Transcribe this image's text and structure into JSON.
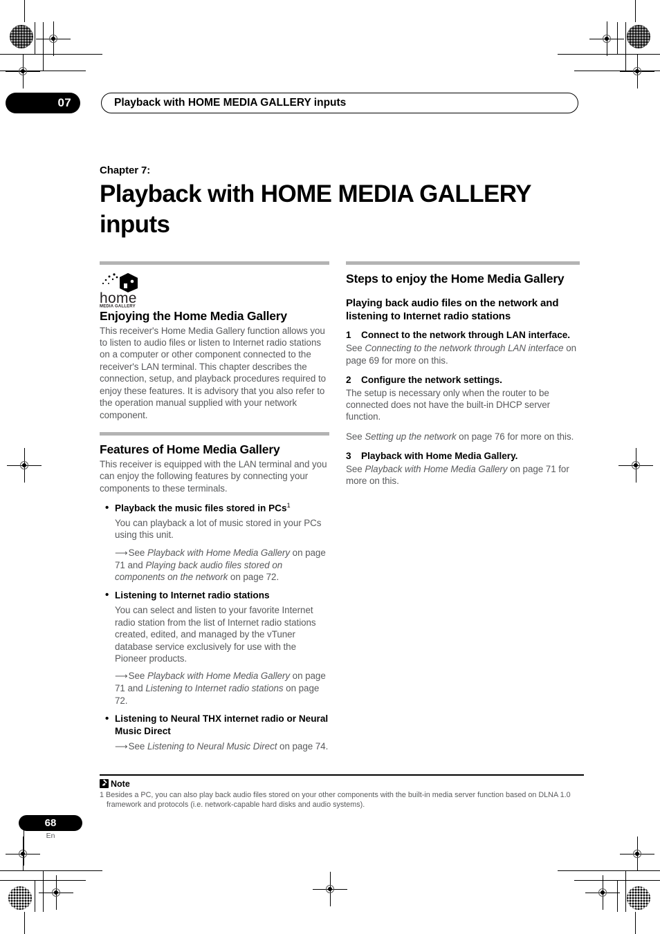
{
  "header": {
    "chapter_number": "07",
    "running_title": "Playback with HOME MEDIA GALLERY inputs"
  },
  "chapter": {
    "label": "Chapter 7:",
    "title": "Playback with HOME MEDIA GALLERY inputs"
  },
  "left_column": {
    "logo": {
      "wordmark": "home",
      "subtext": "MEDIA GALLERY"
    },
    "enjoying": {
      "heading": "Enjoying the Home Media Gallery",
      "body": "This receiver's Home Media Gallery function allows you to listen to audio files or listen to Internet radio stations on a computer or other component connected to the receiver's LAN terminal. This chapter describes the connection, setup, and playback procedures required to enjoy these features. It is advisory that you also refer to the operation manual supplied with your network component."
    },
    "features": {
      "heading": "Features of Home Media Gallery",
      "body": "This receiver is equipped with the LAN terminal and you can enjoy the following features by connecting your components to these terminals.",
      "items": [
        {
          "title": "Playback the music files stored in PCs",
          "footnote_marker": "1",
          "body": "You can playback a lot of music stored in your PCs using this unit.",
          "ref_prefix": "See ",
          "ref_italic_1": "Playback with Home Media Gallery",
          "ref_mid_1": " on page 71 and ",
          "ref_italic_2": "Playing back audio files stored on components on the network",
          "ref_suffix": " on page 72."
        },
        {
          "title": "Listening to Internet radio stations",
          "footnote_marker": "",
          "body": "You can select and listen to your favorite Internet radio station from the list of Internet radio stations created, edited, and managed by the vTuner database service exclusively for use with the Pioneer products.",
          "ref_prefix": "See ",
          "ref_italic_1": "Playback with Home Media Gallery",
          "ref_mid_1": " on page 71 and ",
          "ref_italic_2": "Listening to Internet radio stations",
          "ref_suffix": " on page 72."
        },
        {
          "title": "Listening to Neural THX internet radio or Neural Music Direct",
          "footnote_marker": "",
          "body": "",
          "ref_prefix": "See ",
          "ref_italic_1": "Listening to Neural Music Direct",
          "ref_mid_1": "",
          "ref_italic_2": "",
          "ref_suffix": " on page 74."
        }
      ]
    }
  },
  "right_column": {
    "steps_heading": "Steps to enjoy the Home Media Gallery",
    "subheading": "Playing back audio files on the network and listening to Internet radio stations",
    "steps": [
      {
        "number": "1",
        "title": "Connect to the network through LAN interface.",
        "body_prefix": "See ",
        "body_italic": "Connecting to the network through LAN interface",
        "body_suffix": " on page 69 for more on this.",
        "extra": ""
      },
      {
        "number": "2",
        "title": "Configure the network settings.",
        "body_prefix": "",
        "body_italic": "",
        "body_suffix": "",
        "plain_body": "The setup is necessary only when the router to be connected does not have the built-in DHCP server function.",
        "extra_prefix": "See ",
        "extra_italic": "Setting up the network",
        "extra_suffix": " on page 76 for more on this."
      },
      {
        "number": "3",
        "title": "Playback with Home Media Gallery.",
        "body_prefix": "See ",
        "body_italic": "Playback with Home Media Gallery",
        "body_suffix": " on page 71 for more on this.",
        "extra": ""
      }
    ]
  },
  "note": {
    "icon": "pencil-icon",
    "title": "Note",
    "line1": "1 Besides a PC, you can also play back audio files stored on your other components with the built-in media server function based on DLNA 1.0",
    "line2": "framework and protocols (i.e. network-capable hard disks and audio systems)."
  },
  "footer": {
    "page_number": "68",
    "language": "En"
  },
  "colors": {
    "rule_gray": "#b3b3b3",
    "body_gray": "#58595b",
    "ink_black": "#000000"
  }
}
